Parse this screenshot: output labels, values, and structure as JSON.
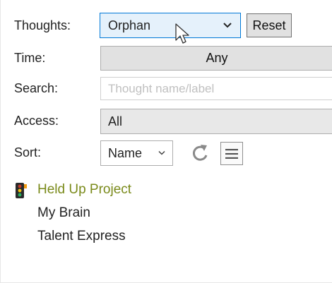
{
  "filters": {
    "thoughts": {
      "label": "Thoughts:",
      "value": "Orphan",
      "reset_label": "Reset"
    },
    "time": {
      "label": "Time:",
      "value": "Any"
    },
    "search": {
      "label": "Search:",
      "placeholder": "Thought name/label"
    },
    "access": {
      "label": "Access:",
      "value": "All"
    },
    "sort": {
      "label": "Sort:",
      "value": "Name"
    }
  },
  "results": [
    {
      "name": "Held Up Project",
      "icon": "traffic-light-icon",
      "color": "#7a8a1a"
    },
    {
      "name": "My Brain"
    },
    {
      "name": "Talent Express"
    }
  ],
  "colors": {
    "selected_dropdown_bg": "#e5f1fb",
    "selected_dropdown_border": "#0078d7",
    "held_up_text": "#7a8a1a"
  }
}
